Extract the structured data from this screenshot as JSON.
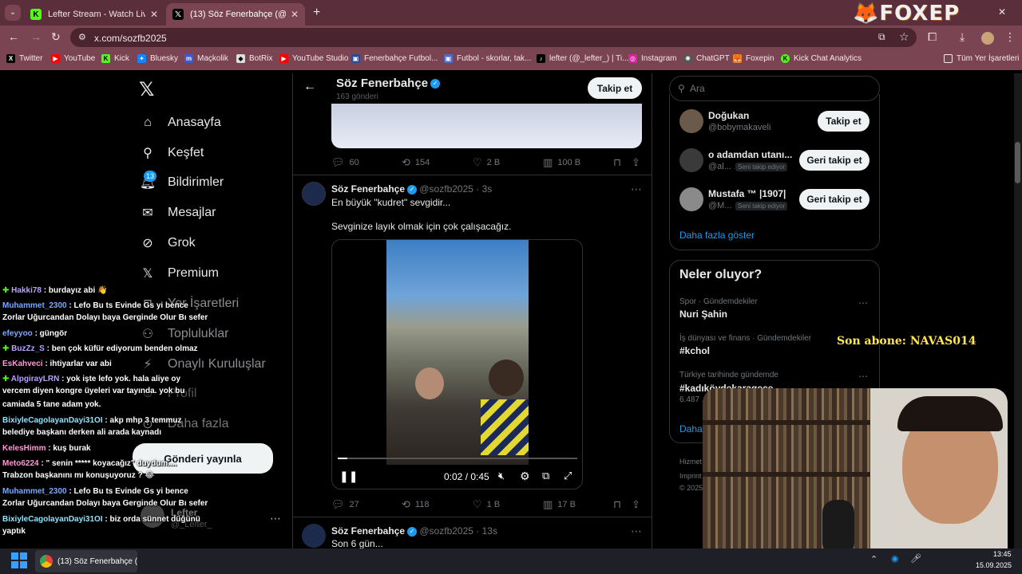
{
  "browser": {
    "tabs": [
      {
        "label": "Lefter Stream - Watch Live on K",
        "active": false
      },
      {
        "label": "(13) Söz Fenerbahçe (@sozfb20",
        "active": true
      }
    ],
    "url": "x.com/sozfb2025",
    "bookmarks": [
      "Twitter",
      "YouTube",
      "Kick",
      "Bluesky",
      "Maçkolik",
      "BotRix",
      "YouTube Studio",
      "Fenerbahçe Futbol...",
      "Futbol - skorlar, tak...",
      "lefter (@_lefter_) | Ti...",
      "Instagram",
      "ChatGPT",
      "Foxepin",
      "Kick Chat Analytics"
    ],
    "all_bookmarks": "Tüm Yer İşaretleri",
    "overlay_logo": "FOXEP"
  },
  "nav": {
    "items": [
      "Anasayfa",
      "Keşfet",
      "Bildirimler",
      "Mesajlar",
      "Grok",
      "Premium",
      "Yer İşaretleri",
      "Topluluklar",
      "Onaylı Kuruluşlar",
      "Profil",
      "Daha fazla"
    ],
    "notif_badge": "13",
    "post_button": "Gönderi yayınla",
    "account_name": "Lefter",
    "account_handle": "@_Lefter_"
  },
  "header": {
    "name": "Söz Fenerbahçe",
    "posts": "163 gönderi",
    "follow": "Takip et"
  },
  "tweet_top": {
    "replies": "60",
    "retweets": "154",
    "likes": "2 B",
    "views": "100 B"
  },
  "tweet_main": {
    "name": "Söz Fenerbahçe",
    "handle": "@sozfb2025",
    "time": "· 3s",
    "line1": "En büyük \"kudret\" sevgidir...",
    "line2": "Sevginize layık olmak için çok çalışacağız.",
    "video_time": "0:02 / 0:45",
    "video_progress": 0.04,
    "replies": "27",
    "retweets": "118",
    "likes": "1 B",
    "views": "17 B"
  },
  "tweet_next": {
    "name": "Söz Fenerbahçe",
    "handle": "@sozfb2025",
    "time": "· 13s",
    "text": "Son 6 gün..."
  },
  "search": {
    "placeholder": "Ara"
  },
  "who_to_follow": {
    "users": [
      {
        "name": "Doğukan",
        "handle": "@bobymakaveli",
        "badge": "",
        "button": "Takip et"
      },
      {
        "name": "o adamdan utanı...",
        "handle": "@al...",
        "badge": "Seni takip ediyor",
        "button": "Geri takip et"
      },
      {
        "name": "Mustafa ™ |1907|",
        "handle": "@M...",
        "badge": "Seni takip ediyor",
        "button": "Geri takip et"
      }
    ],
    "more": "Daha fazla göster"
  },
  "trends": {
    "title": "Neler oluyor?",
    "items": [
      {
        "context": "Spor · Gündemdekiler",
        "title": "Nuri Şahin",
        "count": ""
      },
      {
        "context": "İş dünyası ve finans · Gündemdekiler",
        "title": "#kchol",
        "count": ""
      },
      {
        "context": "Türkiye tarihinde gündemde",
        "title": "#kadıköydekaragece",
        "count": "6.487 ..."
      }
    ],
    "more": "Daha"
  },
  "footer_links": [
    "Hizmet",
    "Imprint",
    "© 2025"
  ],
  "stream": {
    "last_sub": "Son abone: NAVAS014",
    "chat": [
      {
        "user": "Hakki78",
        "msg": ": burdayız abi 👋",
        "color": "#b9a2ff",
        "line2": ""
      },
      {
        "user": "Muhammet_2300",
        "msg": ": Lefo Bu ts Evinde Gs yi bence",
        "color": "#7aa8ff",
        "line2": "Zorlar Uğurcandan Dolayı baya Gerginde Olur Bı sefer"
      },
      {
        "user": "efeyyoo",
        "msg": ": güngör",
        "color": "#7aa8ff",
        "line2": ""
      },
      {
        "user": "BuzZz_S",
        "msg": ": ben çok küfür ediyorum benden olmaz",
        "color": "#b9a2ff",
        "line2": ""
      },
      {
        "user": "EsKahveci",
        "msg": ": ihtiyarlar var abi",
        "color": "#ff9ad5",
        "line2": ""
      },
      {
        "user": "AlpgirayLRN",
        "msg": ": yok işte lefo yok. hala aliye oy",
        "color": "#b9a2ff",
        "line2": "vercem diyen kongre üyeleri var tayında. yok bu"
      },
      {
        "user": "",
        "msg": "camiada 5 tane adam yok.",
        "color": "#ffffff",
        "line2": ""
      },
      {
        "user": "BixiyleCagolayanDayi31OI",
        "msg": ": akp mhp 3 temmuz",
        "color": "#8fe3ff",
        "line2": "belediye başkanı derken ali arada kaynadı"
      },
      {
        "user": "KelesHimm",
        "msg": ": kuş burak",
        "color": "#ff9ad5",
        "line2": ""
      },
      {
        "user": "Meto6224",
        "msg": ": \" senin ***** koyacağız\" duydum....",
        "color": "#ff9ad5",
        "line2": "Trabzon başkanını mı konuşuyoruz ? 😂"
      },
      {
        "user": "Muhammet_2300",
        "msg": ": Lefo Bu ts Evinde Gs yi bence",
        "color": "#7aa8ff",
        "line2": "Zorlar Uğurcandan Dolayı baya Gerginde Olur Bı sefer"
      },
      {
        "user": "BixiyleCagolayanDayi31OI",
        "msg": ": biz orda sünnet düğünü",
        "color": "#8fe3ff",
        "line2": "yaptık"
      }
    ]
  },
  "taskbar": {
    "task_label": "(13) Söz Fenerbahçe (@s",
    "time": "13:45",
    "date": "15.09.2025"
  },
  "colors": {
    "x_blue": "#1d9bf0",
    "chrome_tab": "#5a2e3a",
    "chrome_nav": "#7b4452",
    "sub_text": "#ffe74a"
  }
}
